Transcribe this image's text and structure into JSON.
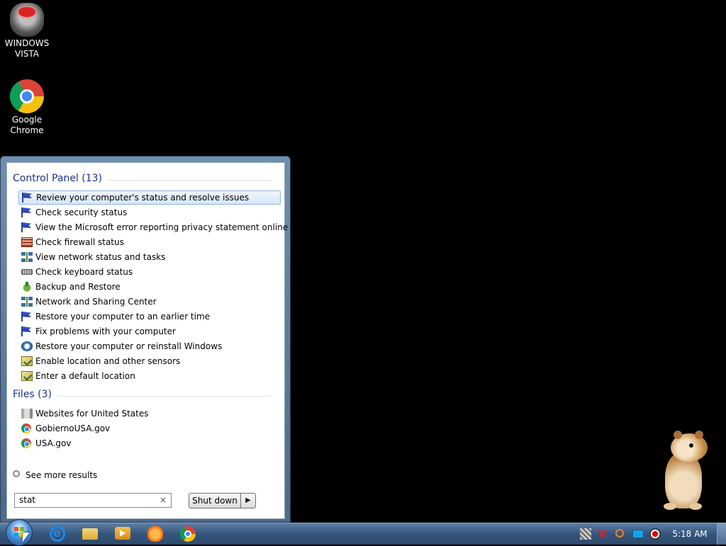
{
  "desktop": {
    "icons": [
      {
        "label_line1": "WINDOWS",
        "label_line2": "VISTA",
        "icon": "windows-vista-shortcut-icon"
      },
      {
        "label_line1": "Google",
        "label_line2": "Chrome",
        "icon": "chrome-icon"
      }
    ]
  },
  "start_menu": {
    "groups": [
      {
        "title": "Control Panel (13)",
        "items": [
          {
            "label": "Review your computer's status and resolve issues",
            "icon": "action-center-flag-icon",
            "selected": true
          },
          {
            "label": "Check security status",
            "icon": "action-center-flag-icon"
          },
          {
            "label": "View the Microsoft error reporting privacy statement online",
            "icon": "action-center-flag-icon"
          },
          {
            "label": "Check firewall status",
            "icon": "firewall-icon"
          },
          {
            "label": "View network status and tasks",
            "icon": "network-icon"
          },
          {
            "label": "Check keyboard status",
            "icon": "keyboard-icon"
          },
          {
            "label": "Backup and Restore",
            "icon": "backup-icon"
          },
          {
            "label": "Network and Sharing Center",
            "icon": "network-icon"
          },
          {
            "label": "Restore your computer to an earlier time",
            "icon": "action-center-flag-icon"
          },
          {
            "label": "Fix problems with your computer",
            "icon": "action-center-flag-icon"
          },
          {
            "label": "Restore your computer or reinstall Windows",
            "icon": "recovery-icon"
          },
          {
            "label": "Enable location and other sensors",
            "icon": "sensor-icon"
          },
          {
            "label": "Enter a default location",
            "icon": "sensor-icon"
          }
        ]
      },
      {
        "title": "Files (3)",
        "items": [
          {
            "label": "Websites for United States",
            "icon": "favorites-book-icon"
          },
          {
            "label": "GobiernoUSA.gov",
            "icon": "chrome-icon"
          },
          {
            "label": "USA.gov",
            "icon": "chrome-icon"
          }
        ]
      }
    ],
    "see_more": "See more results",
    "search_value": "stat",
    "clear_glyph": "×",
    "shutdown_label": "Shut down",
    "shutdown_arrow": "▶"
  },
  "taskbar": {
    "pinned": [
      "internet-explorer-icon",
      "windows-explorer-icon",
      "media-player-icon",
      "uc-browser-icon",
      "chrome-icon"
    ],
    "tray": [
      "app-tray-icon",
      "vivaldi-tray-icon",
      "search-tray-icon",
      "display-tray-icon",
      "recorder-tray-icon"
    ],
    "tray_v": "V",
    "clock": "5:18 AM"
  },
  "colors": {
    "group_header": "#1e3287",
    "taskbar": "#35557c",
    "selection_border": "#8fb3df"
  }
}
